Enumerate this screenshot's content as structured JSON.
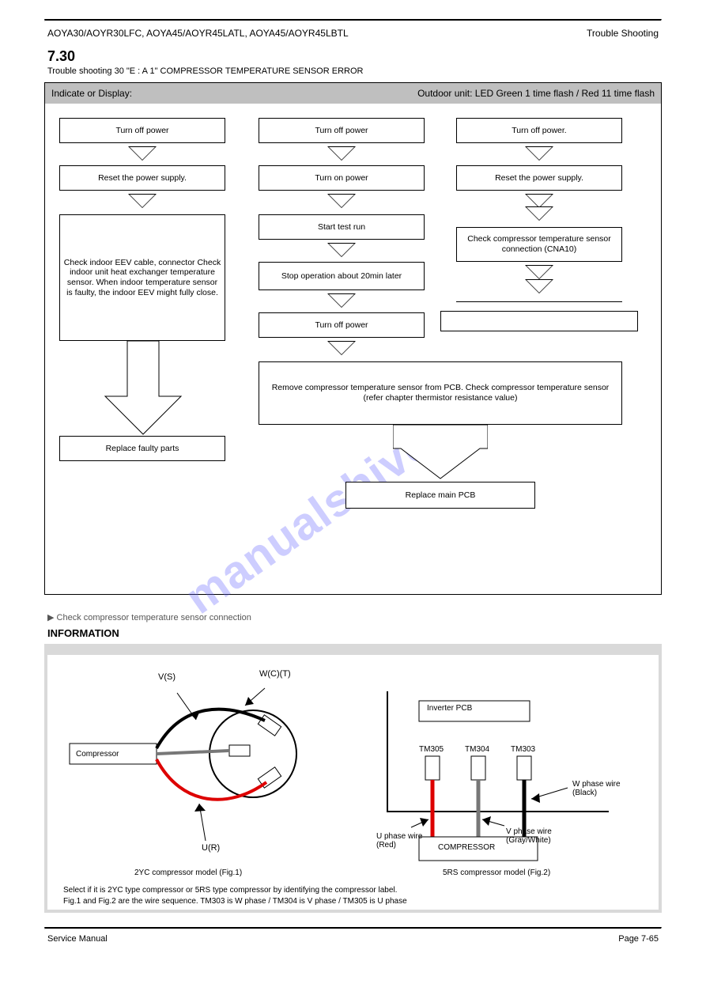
{
  "header": {
    "series": "AOYA30/AOYR30LFC, AOYA45/AOYR45LATL, AOYA45/AOYR45LBTL",
    "title_right": "Trouble Shooting"
  },
  "section": {
    "number": "7.30",
    "title": "Trouble shooting 30 \"E : A 1\" COMPRESSOR TEMPERATURE SENSOR ERROR"
  },
  "flow": {
    "header_left": "Indicate or Display:",
    "header_right": "Outdoor unit: LED Green 1 time flash / Red 11 time flash",
    "col1": {
      "a": "Turn off power",
      "b": "Reset the power supply.",
      "c": "Check indoor EEV cable, connector Check indoor unit heat exchanger temperature sensor. When indoor temperature sensor is faulty, the indoor EEV might fully close."
    },
    "col2": {
      "a": "Turn off power",
      "b": "Turn on power",
      "c": "Start test run",
      "d": "Stop operation about 20min later",
      "e": "Turn off power"
    },
    "col3": {
      "a": "Turn off power.",
      "b": "Reset the power supply.",
      "c": "Check compressor temperature sensor connection (CNA10)"
    },
    "merge": {
      "m1": "Remove compressor temperature sensor from PCB. Check compressor temperature sensor (refer chapter thermistor resistance value)",
      "m2": "Replace main PCB"
    },
    "end1": "Replace faulty parts"
  },
  "note_line": "▶ Check compressor temperature sensor connection",
  "info_title": "INFORMATION",
  "info": {
    "fig1_caption": "2YC compressor model (Fig.1)",
    "fig2_caption": "5RS compressor model (Fig.2)",
    "notes_line1": "Select if it is 2YC type compressor or 5RS type compressor by identifying the compressor label.",
    "notes_line2": "Fig.1 and Fig.2 are the wire sequence. TM303 is W phase / TM304 is V phase / TM305 is U phase",
    "label_vs": "V(S)",
    "label_wct": "W(C)(T)",
    "label_ur": "U(R)",
    "label_comp": "Compressor",
    "label_board": "Inverter PCB",
    "tm305": "TM305",
    "tm304": "TM304",
    "tm303": "TM303",
    "w_wire": "W phase wire (Black)",
    "u_wire": "U phase wire (Red)",
    "v_wire": "V phase wire (Gray/White)",
    "comp_right": "COMPRESSOR"
  },
  "footer": {
    "left": "Service Manual",
    "right": "Page 7-65"
  },
  "watermark": "manualshive.com"
}
